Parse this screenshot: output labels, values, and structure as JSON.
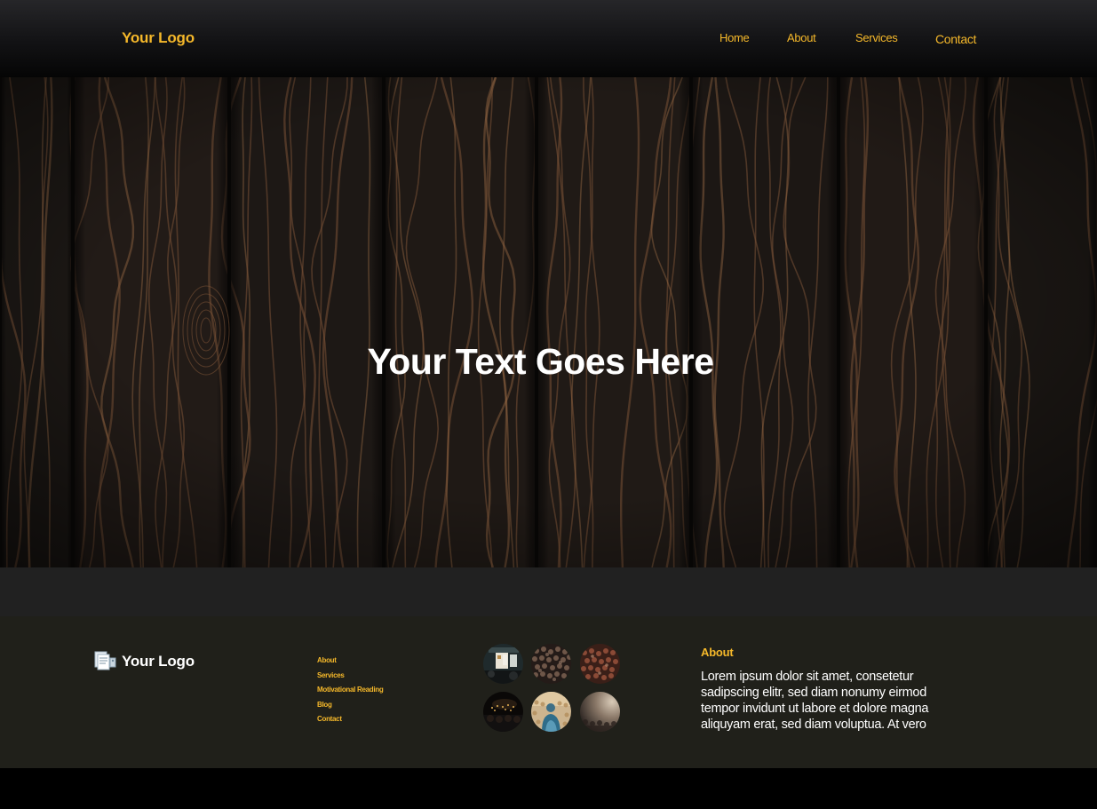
{
  "header": {
    "logo": "Your Logo",
    "nav": [
      {
        "label": "Home"
      },
      {
        "label": "About"
      },
      {
        "label": "Services"
      },
      {
        "label": "Contact"
      }
    ]
  },
  "hero": {
    "title": "Your Text Goes Here",
    "background": "dark-wood-planks"
  },
  "footer": {
    "logo": "Your Logo",
    "logo_icon": "document-icon",
    "links": [
      {
        "label": "About"
      },
      {
        "label": "Services"
      },
      {
        "label": "Motivational Reading"
      },
      {
        "label": "Blog"
      },
      {
        "label": "Contact"
      }
    ],
    "gallery": [
      {
        "name": "presentation-photo"
      },
      {
        "name": "crowd-photo"
      },
      {
        "name": "audience-photo"
      },
      {
        "name": "concert-photo"
      },
      {
        "name": "speaker-photo"
      },
      {
        "name": "stage-photo"
      }
    ],
    "about_title": "About",
    "about_text": "Lorem ipsum dolor sit amet, consetetur sadipscing elitr, sed diam nonumy eirmod tempor invidunt ut labore et dolore magna aliquyam erat, sed diam voluptua. At vero"
  },
  "colors": {
    "accent": "#f5b82a",
    "footer_bg": "#20201a",
    "band_bg": "#212121"
  }
}
